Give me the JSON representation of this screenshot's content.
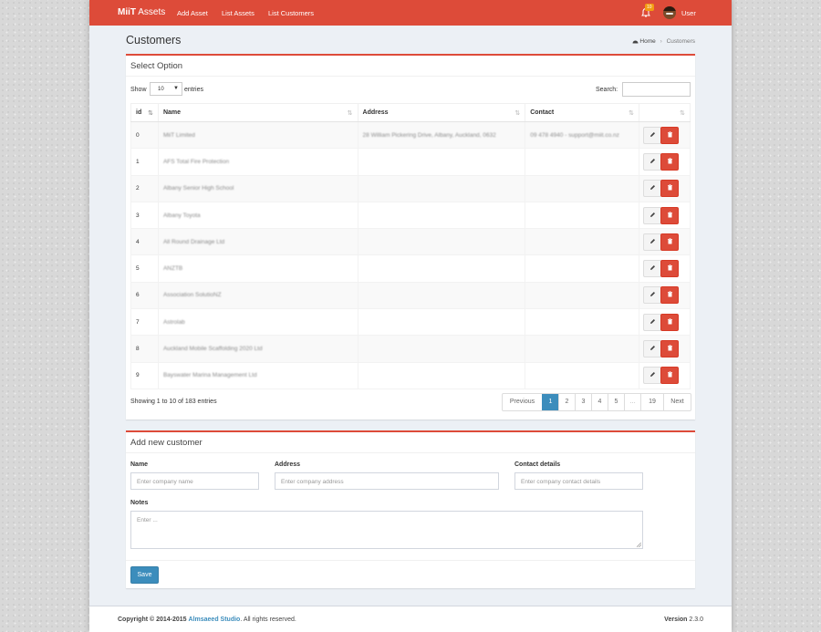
{
  "header": {
    "brand_bold": "MiiT",
    "brand_rest": "Assets",
    "nav": [
      "Add Asset",
      "List Assets",
      "List Customers"
    ],
    "notification_count": "10",
    "user": "User",
    "accent_color": "#dd4b39"
  },
  "page": {
    "title": "Customers",
    "breadcrumb": [
      "Home",
      "Customers"
    ]
  },
  "table_box": {
    "title": "Select Option",
    "show_label": "Show",
    "entries_value": "10",
    "entries_label": "entries",
    "search_label": "Search:",
    "columns": [
      "id",
      "Name",
      "Address",
      "Contact",
      ""
    ],
    "rows": [
      {
        "id": "0",
        "name": "MiiT Limited",
        "address": "28 William Pickering Drive, Albany, Auckland, 0632",
        "contact": "09 478 4940 - support@miit.co.nz"
      },
      {
        "id": "1",
        "name": "AFS Total Fire Protection",
        "address": "",
        "contact": ""
      },
      {
        "id": "2",
        "name": "Albany Senior High School",
        "address": "",
        "contact": ""
      },
      {
        "id": "3",
        "name": "Albany Toyota",
        "address": "",
        "contact": ""
      },
      {
        "id": "4",
        "name": "All Round Drainage Ltd",
        "address": "",
        "contact": ""
      },
      {
        "id": "5",
        "name": "ANZTB",
        "address": "",
        "contact": ""
      },
      {
        "id": "6",
        "name": "Association SolutioNZ",
        "address": "",
        "contact": ""
      },
      {
        "id": "7",
        "name": "Astrolab",
        "address": "",
        "contact": ""
      },
      {
        "id": "8",
        "name": "Auckland Mobile Scaffolding 2020 Ltd",
        "address": "",
        "contact": ""
      },
      {
        "id": "9",
        "name": "Bayswater Marina Management Ltd",
        "address": "",
        "contact": ""
      }
    ],
    "info": "Showing 1 to 10 of 183 entries",
    "pagination": [
      "Previous",
      "1",
      "2",
      "3",
      "4",
      "5",
      "…",
      "19",
      "Next"
    ],
    "active_page": "1"
  },
  "form_box": {
    "title": "Add new customer",
    "name_label": "Name",
    "name_placeholder": "Enter company name",
    "address_label": "Address",
    "address_placeholder": "Enter company address",
    "contact_label": "Contact details",
    "contact_placeholder": "Enter company contact details",
    "notes_label": "Notes",
    "notes_placeholder": "Enter ...",
    "save_label": "Save"
  },
  "footer": {
    "copyright_prefix": "Copyright © 2014-2015",
    "studio": "Almsaeed Studio",
    "copyright_suffix": ". All rights reserved.",
    "version_label": "Version",
    "version": "2.3.0"
  }
}
